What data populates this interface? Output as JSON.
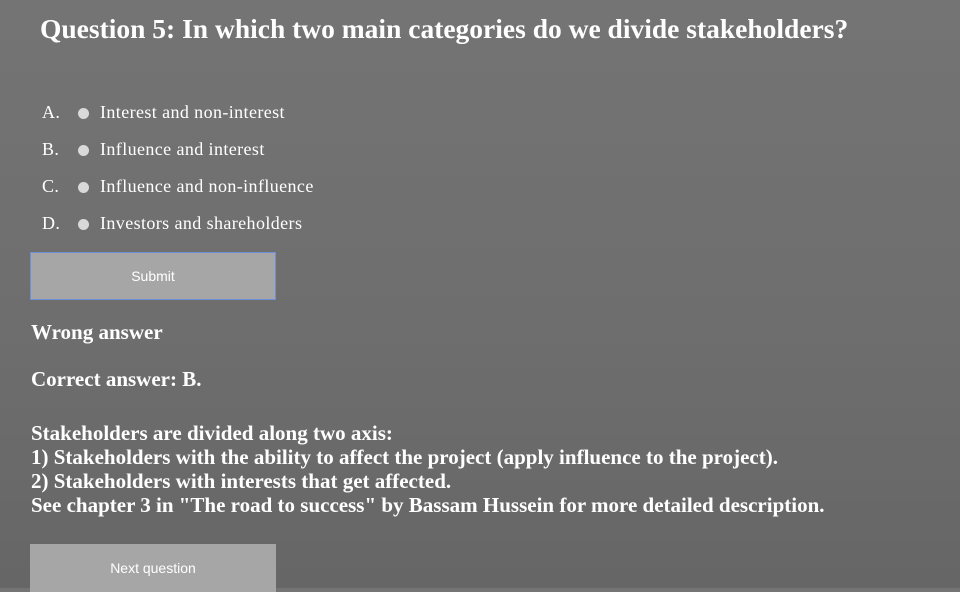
{
  "question": {
    "title": "Question 5: In which two main categories do we divide stakeholders?"
  },
  "options": [
    {
      "letter": "A.",
      "label": "Interest and non-interest"
    },
    {
      "letter": "B.",
      "label": "Influence and interest"
    },
    {
      "letter": "C.",
      "label": "Influence and non-influence"
    },
    {
      "letter": "D.",
      "label": "Investors and shareholders"
    }
  ],
  "submit_label": "Submit",
  "feedback": {
    "result": "Wrong answer",
    "correct_answer": "Correct answer: B."
  },
  "explanation": {
    "lines": [
      "Stakeholders are divided along two axis:",
      "1) Stakeholders with the ability to affect the project (apply influence to the project).",
      "2) Stakeholders with interests that get affected.",
      "See chapter 3 in \"The road to success\" by Bassam Hussein for more detailed description."
    ]
  },
  "next_label": "Next question"
}
